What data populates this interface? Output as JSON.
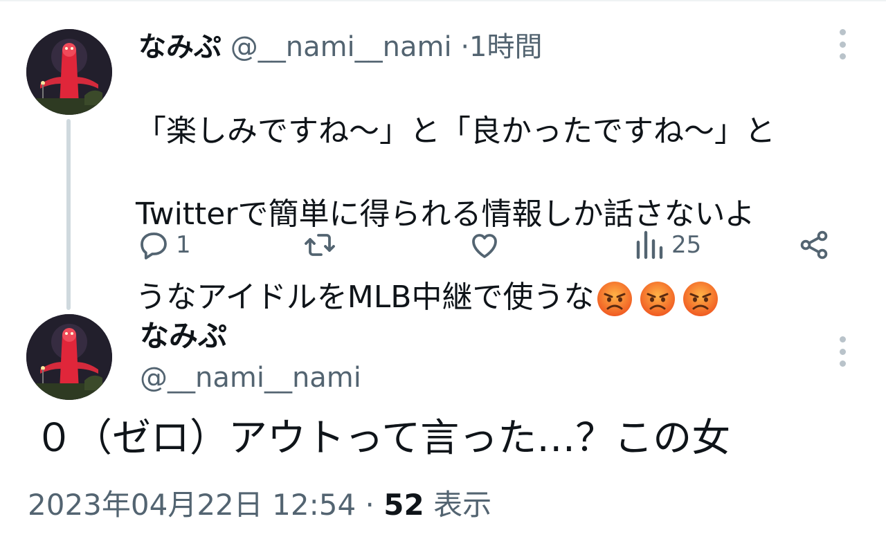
{
  "reply_tweet": {
    "author_name": "なみぷ",
    "handle": "@__nami__nami",
    "separator": "·",
    "time": "1時間",
    "text_lines": [
      "「楽しみですね〜」と「良かったですね〜」と",
      "Twitterで簡単に得られる情報しか話さないよ",
      "うなアイドルをMLB中継で使うな"
    ],
    "emojis": [
      "angry-face",
      "angry-face",
      "angry-face"
    ],
    "actions": {
      "reply_count": "1",
      "retweet_count": "",
      "like_count": "",
      "views_count": "25"
    }
  },
  "main_tweet": {
    "author_name": "なみぷ",
    "handle": "@__nami__nami",
    "text": "０（ゼロ）アウトって言った…？この女",
    "date": "2023年04月22日 12:54",
    "separator": "·",
    "views_count": "52",
    "views_label": "表示"
  },
  "colors": {
    "text_primary": "#0f1419",
    "text_secondary": "#536471",
    "thread_line": "#cfd9de",
    "avatar_tower": "#e0263a"
  },
  "icons": [
    "reply-icon",
    "retweet-icon",
    "like-icon",
    "views-icon",
    "share-icon",
    "more-icon"
  ]
}
